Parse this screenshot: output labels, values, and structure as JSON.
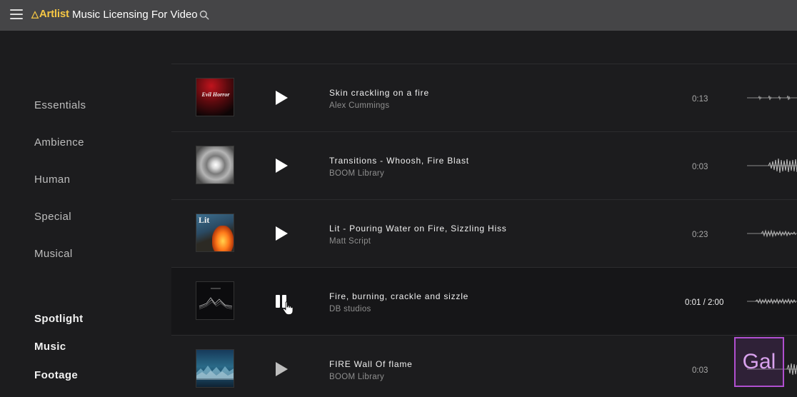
{
  "header": {
    "logo_text": "Artlist",
    "title": "Music Licensing For Video",
    "menu_icon": "hamburger-menu-icon",
    "search_icon": "search-icon"
  },
  "sidebar": {
    "categories": [
      "Essentials",
      "Ambience",
      "Human",
      "Special",
      "Musical"
    ],
    "sections": [
      "Spotlight",
      "Music",
      "Footage"
    ]
  },
  "tracks": [
    {
      "title": "Skin crackling on a fire",
      "artist": "Alex Cummings",
      "duration": "0:13",
      "state": "paused",
      "cover_text": "Evil Horror"
    },
    {
      "title": "Transitions - Whoosh, Fire Blast",
      "artist": "BOOM Library",
      "duration": "0:03",
      "state": "paused",
      "cover_text": ""
    },
    {
      "title": "Lit - Pouring Water on Fire, Sizzling Hiss",
      "artist": "Matt Script",
      "duration": "0:23",
      "state": "paused",
      "cover_text": "Lit"
    },
    {
      "title": "Fire, burning, crackle and sizzle",
      "artist": "DB studios",
      "duration": "0:01 / 2:00",
      "state": "playing",
      "cover_text": ""
    },
    {
      "title": "FIRE Wall Of flame",
      "artist": "BOOM Library",
      "duration": "0:03",
      "state": "paused",
      "cover_text": ""
    }
  ],
  "watermark": {
    "text": "Gal"
  },
  "colors": {
    "brand": "#f6c744",
    "topbar": "#454547",
    "background": "#1c1c1e",
    "badge": "#b04fd0"
  }
}
